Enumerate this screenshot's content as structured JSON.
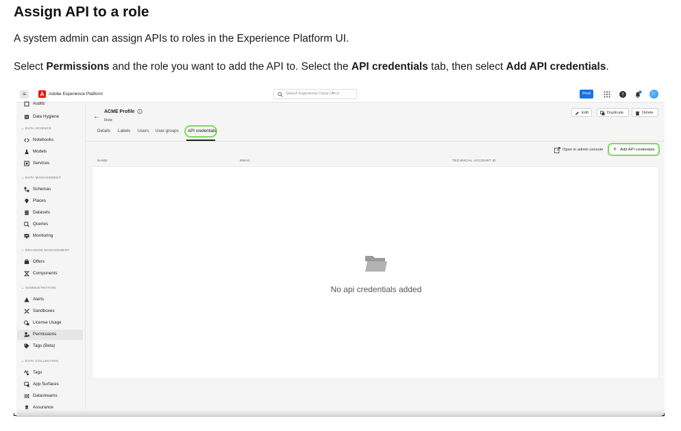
{
  "doc": {
    "title": "Assign API to a role",
    "intro": "A system admin can assign APIs to roles in the Experience Platform UI.",
    "instruction": {
      "t1": "Select ",
      "b1": "Permissions",
      "t2": " and the role you want to add the API to. Select the ",
      "b2": "API credentials",
      "t3": " tab, then select ",
      "b3": "Add API credentials",
      "t4": "."
    }
  },
  "topbar": {
    "app_title": "Adobe Experience Platform",
    "search_placeholder": "Search Experience Cloud (⌘+/)",
    "env_badge": "Prod"
  },
  "sidebar": {
    "items": [
      {
        "label": "Audits",
        "icon": "audit-icon"
      },
      {
        "label": "Data Hygiene",
        "icon": "data-hygiene-icon"
      },
      {
        "section": "DATA SCIENCE"
      },
      {
        "label": "Notebooks",
        "icon": "code-icon"
      },
      {
        "label": "Models",
        "icon": "flask-icon"
      },
      {
        "label": "Services",
        "icon": "services-icon"
      },
      {
        "section": "DATA MANAGEMENT"
      },
      {
        "label": "Schemas",
        "icon": "schema-icon"
      },
      {
        "label": "Places",
        "icon": "pin-icon"
      },
      {
        "label": "Datasets",
        "icon": "database-icon"
      },
      {
        "label": "Queries",
        "icon": "query-icon"
      },
      {
        "label": "Monitoring",
        "icon": "monitoring-icon"
      },
      {
        "section": "DECISION MANAGEMENT"
      },
      {
        "label": "Offers",
        "icon": "offers-icon"
      },
      {
        "label": "Components",
        "icon": "components-icon"
      },
      {
        "section": "ADMINISTRATION"
      },
      {
        "label": "Alerts",
        "icon": "alert-icon"
      },
      {
        "label": "Sandboxes",
        "icon": "tools-icon"
      },
      {
        "label": "License Usage",
        "icon": "license-icon"
      },
      {
        "label": "Permissions",
        "icon": "permissions-icon",
        "active": true
      },
      {
        "label": "Tags (Beta)",
        "icon": "tag-icon"
      },
      {
        "section": "DATA COLLECTION"
      },
      {
        "label": "Tags",
        "icon": "tags-icon"
      },
      {
        "label": "App Surfaces",
        "icon": "app-surfaces-icon"
      },
      {
        "label": "Datastreams",
        "icon": "datastreams-icon"
      },
      {
        "label": "Assurance",
        "icon": "assurance-icon"
      }
    ]
  },
  "role": {
    "name": "ACME Profile",
    "type": "Role",
    "edit_label": "Edit",
    "duplicate_label": "Duplicate",
    "delete_label": "Delete"
  },
  "tabs": {
    "details": "Details",
    "labels": "Labels",
    "users": "Users",
    "user_groups": "User groups",
    "api_credentials": "API credentials"
  },
  "actions": {
    "open_admin": "Open in admin console",
    "add_api": "Add API credentials"
  },
  "table": {
    "columns": [
      "NAME",
      "EMAIL",
      "TECHNICAL ACCOUNT ID"
    ],
    "empty_message": "No api credentials added"
  },
  "colors": {
    "highlight": "#7ed957",
    "accent": "#1473e6",
    "brand": "#eb1000"
  }
}
